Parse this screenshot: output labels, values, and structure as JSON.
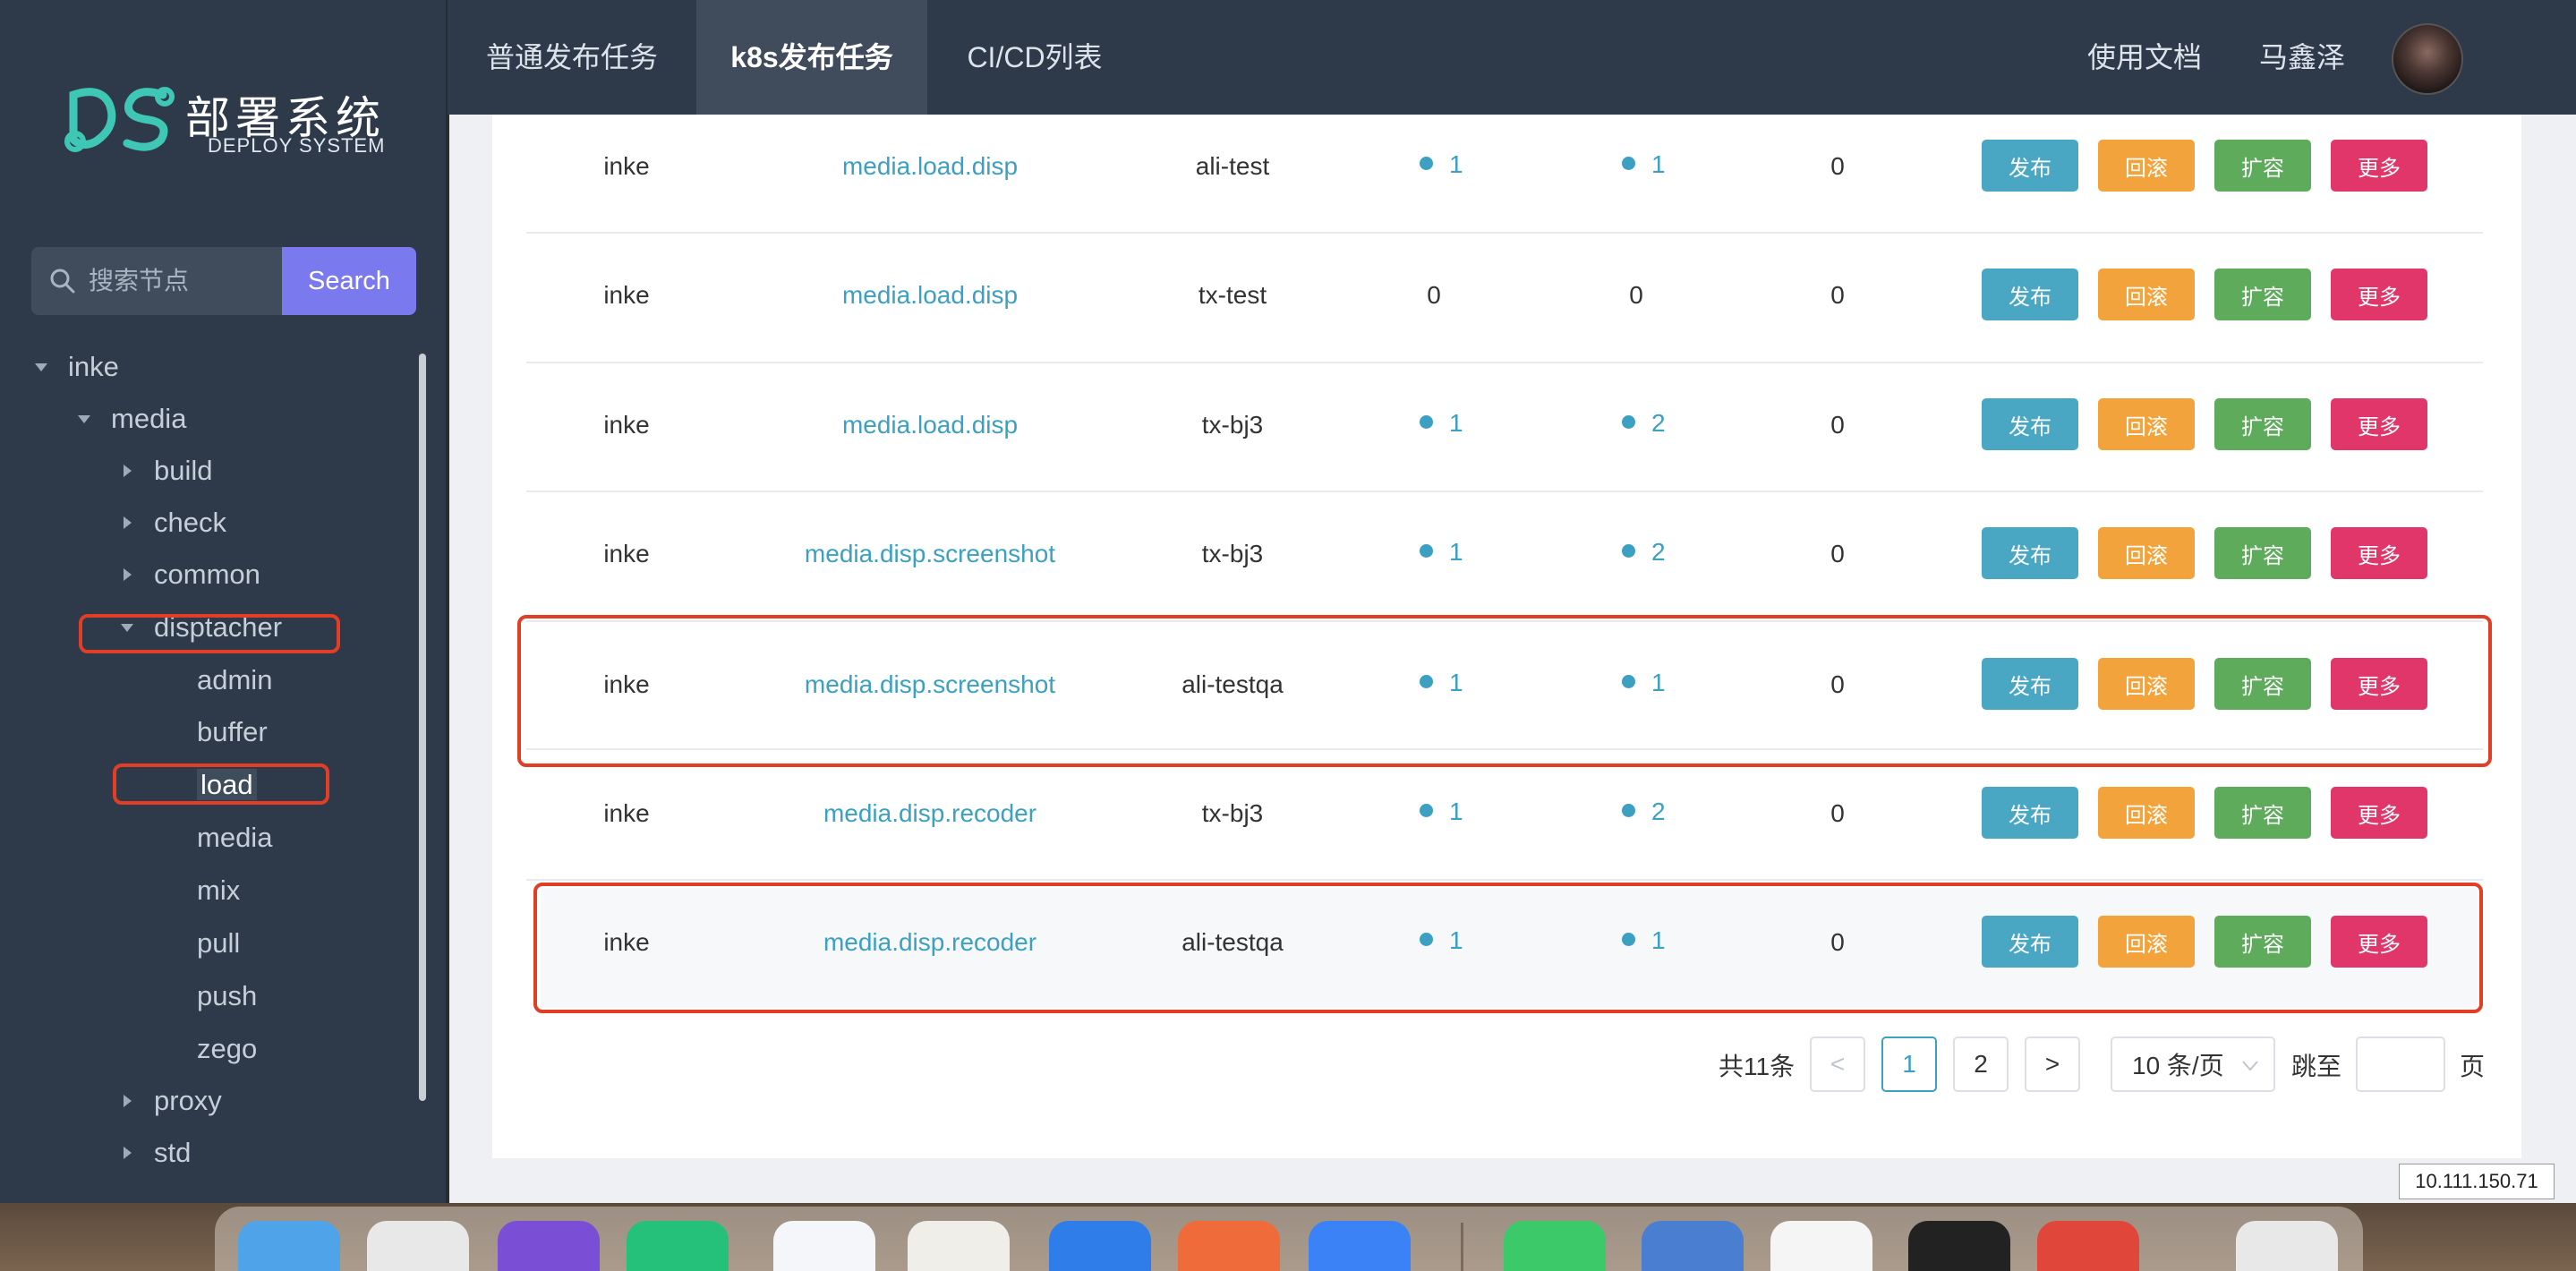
{
  "app": {
    "logo_cn": "部署系统",
    "logo_en": "DEPLOY SYSTEM"
  },
  "search": {
    "placeholder": "搜索节点",
    "button": "Search"
  },
  "tree": [
    {
      "label": "inke",
      "level": 0,
      "expanded": true
    },
    {
      "label": "media",
      "level": 1,
      "expanded": true
    },
    {
      "label": "build",
      "level": 2,
      "expanded": false
    },
    {
      "label": "check",
      "level": 2,
      "expanded": false
    },
    {
      "label": "common",
      "level": 2,
      "expanded": false
    },
    {
      "label": "disptacher",
      "level": 2,
      "expanded": true
    },
    {
      "label": "admin",
      "level": 3
    },
    {
      "label": "buffer",
      "level": 3
    },
    {
      "label": "load",
      "level": 3,
      "selected": true
    },
    {
      "label": "media",
      "level": 3
    },
    {
      "label": "mix",
      "level": 3
    },
    {
      "label": "pull",
      "level": 3
    },
    {
      "label": "push",
      "level": 3
    },
    {
      "label": "zego",
      "level": 3
    },
    {
      "label": "proxy",
      "level": 2,
      "expanded": false
    },
    {
      "label": "std",
      "level": 2,
      "expanded": false
    }
  ],
  "nav": {
    "tabs": [
      {
        "label": "普通发布任务",
        "active": false
      },
      {
        "label": "k8s发布任务",
        "active": true
      },
      {
        "label": "CI/CD列表",
        "active": false
      }
    ],
    "docs": "使用文档",
    "user": "马鑫泽"
  },
  "actions": {
    "publish": "发布",
    "rollback": "回滚",
    "scale": "扩容",
    "more": "更多"
  },
  "rows": [
    {
      "project": "inke",
      "service": "media.load.disp",
      "cluster": "ali-test",
      "a": "1",
      "a_dot": true,
      "b": "1",
      "b_dot": true,
      "c": "0",
      "highlighted": false
    },
    {
      "project": "inke",
      "service": "media.load.disp",
      "cluster": "tx-test",
      "a": "0",
      "a_dot": false,
      "b": "0",
      "b_dot": false,
      "c": "0",
      "highlighted": false
    },
    {
      "project": "inke",
      "service": "media.load.disp",
      "cluster": "tx-bj3",
      "a": "1",
      "a_dot": true,
      "b": "2",
      "b_dot": true,
      "c": "0",
      "highlighted": false
    },
    {
      "project": "inke",
      "service": "media.disp.screenshot",
      "cluster": "tx-bj3",
      "a": "1",
      "a_dot": true,
      "b": "2",
      "b_dot": true,
      "c": "0",
      "highlighted": false
    },
    {
      "project": "inke",
      "service": "media.disp.screenshot",
      "cluster": "ali-testqa",
      "a": "1",
      "a_dot": true,
      "b": "1",
      "b_dot": true,
      "c": "0",
      "highlighted": true
    },
    {
      "project": "inke",
      "service": "media.disp.recoder",
      "cluster": "tx-bj3",
      "a": "1",
      "a_dot": true,
      "b": "2",
      "b_dot": true,
      "c": "0",
      "highlighted": false
    },
    {
      "project": "inke",
      "service": "media.disp.recoder",
      "cluster": "ali-testqa",
      "a": "1",
      "a_dot": true,
      "b": "1",
      "b_dot": true,
      "c": "0",
      "highlighted": true
    }
  ],
  "pagination": {
    "total": "共11条",
    "prev": "<",
    "pages": [
      "1",
      "2"
    ],
    "current": "1",
    "next": ">",
    "page_size": "10 条/页",
    "jump_label": "跳至",
    "jump_value": "",
    "page_suffix": "页"
  },
  "ip_tag": "10.111.150.71",
  "colors": {
    "sidebar": "#2e3a4a",
    "accent": "#3ba0c2",
    "search_button": "#7b79ee",
    "publish": "#4aa7c4",
    "rollback": "#f2a33b",
    "scale": "#5dab5b",
    "more": "#e0366a",
    "highlight_box": "#e23d25"
  },
  "dock_apps": [
    "finder-icon",
    "chrome-icon",
    "goland-icon",
    "clion-icon",
    "vscode-icon",
    "sequel-pro-icon",
    "safari-icon",
    "postman-icon",
    "lark-icon",
    "wechat-icon",
    "dictionary-icon",
    "typora-icon",
    "terminal-icon",
    "pdf-icon",
    "trash-icon"
  ]
}
